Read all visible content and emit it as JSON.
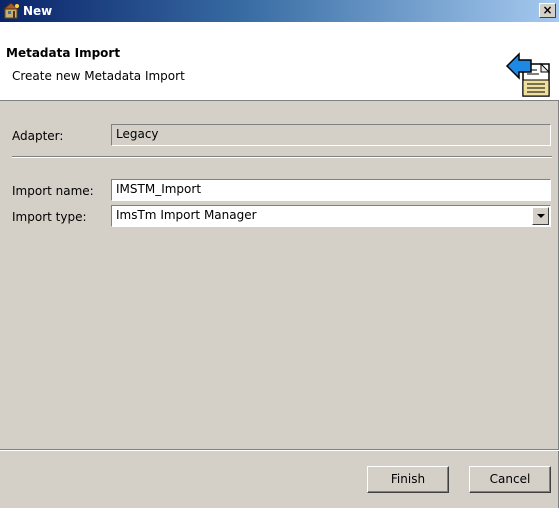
{
  "window": {
    "title": "New",
    "title_icon": "wizard-icon",
    "close_label": "×"
  },
  "banner": {
    "title": "Metadata Import",
    "description": "Create new Metadata Import",
    "icon": "metadata-import-icon"
  },
  "form": {
    "adapter_label": "Adapter:",
    "adapter_value": "Legacy",
    "import_name_label": "Import name:",
    "import_name_value": "IMSTM_Import",
    "import_type_label": "Import type:",
    "import_type_value": "ImsTm Import Manager"
  },
  "buttons": {
    "finish_label": "Finish",
    "cancel_label": "Cancel"
  }
}
